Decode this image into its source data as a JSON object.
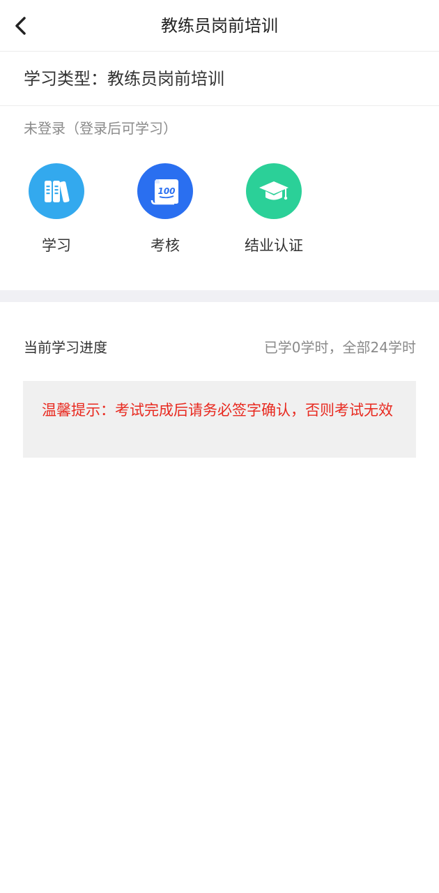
{
  "header": {
    "title": "教练员岗前培训",
    "back_icon": "chevron-left-icon"
  },
  "study_type": {
    "text": "学习类型：教练员岗前培训"
  },
  "login_status": {
    "text": "未登录（登录后可学习）"
  },
  "features": [
    {
      "label": "学习",
      "icon": "books-icon",
      "color": "#33a9ee"
    },
    {
      "label": "考核",
      "icon": "exam-scroll-icon",
      "color": "#2a6ff0",
      "icon_text": "100"
    },
    {
      "label": "结业认证",
      "icon": "graduation-cap-icon",
      "color": "#2bd098"
    }
  ],
  "progress": {
    "label": "当前学习进度",
    "value": "已学0学时，全部24学时"
  },
  "notice": {
    "text": "温馨提示：考试完成后请务必签字确认，否则考试无效",
    "color": "#e8291f"
  }
}
